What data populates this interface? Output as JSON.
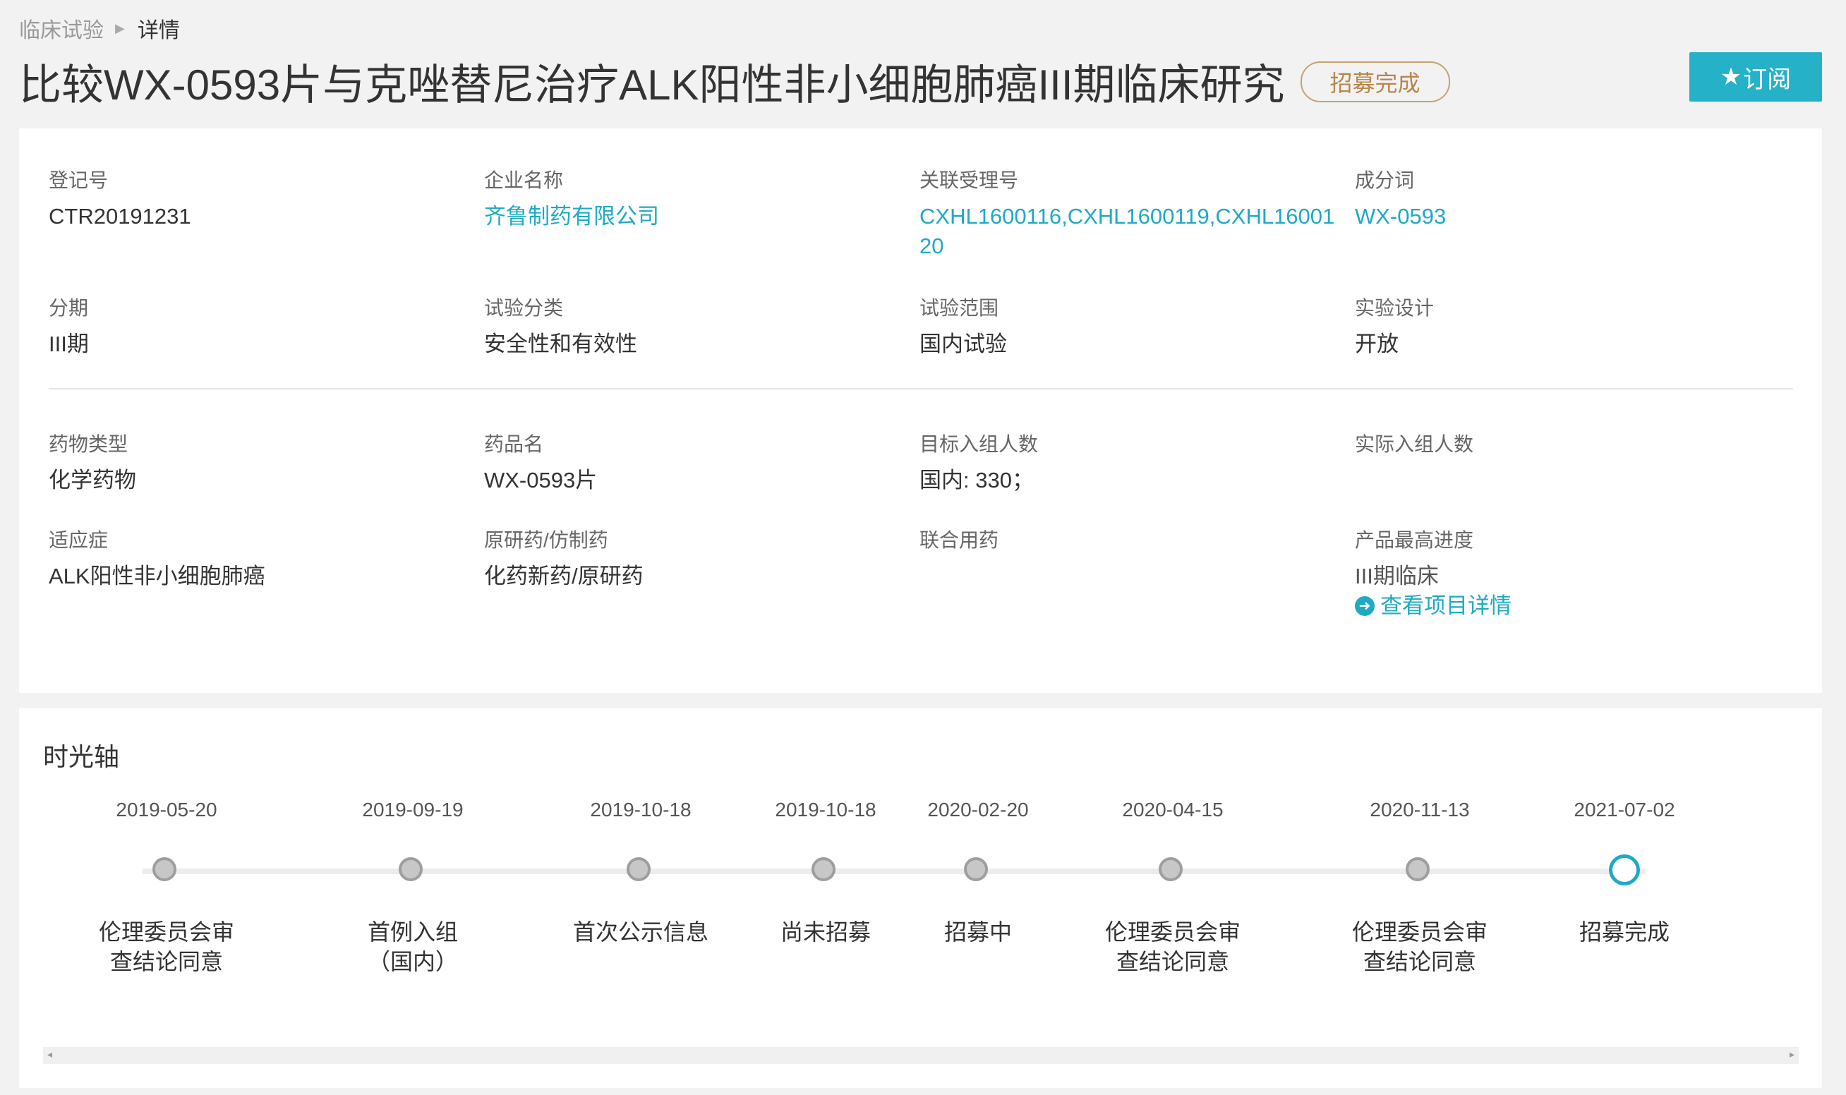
{
  "breadcrumb": {
    "parent": "临床试验",
    "current": "详情"
  },
  "header": {
    "title": "比较WX-0593片与克唑替尼治疗ALK阳性非小细胞肺癌III期临床研究",
    "status": "招募完成",
    "subscribe_label": "订阅"
  },
  "colors": {
    "accent": "#25b1c8",
    "link": "#1eaac3",
    "badge": "#c8a16e"
  },
  "fields": {
    "reg_no": {
      "label": "登记号",
      "value": "CTR20191231"
    },
    "company": {
      "label": "企业名称",
      "value": "齐鲁制药有限公司"
    },
    "related_accept": {
      "label": "关联受理号",
      "value": "CXHL1600116,CXHL1600119,CXHL1600120"
    },
    "ingredient": {
      "label": "成分词",
      "value": "WX-0593"
    },
    "phase": {
      "label": "分期",
      "value": "III期"
    },
    "trial_type": {
      "label": "试验分类",
      "value": "安全性和有效性"
    },
    "trial_scope": {
      "label": "试验范围",
      "value": "国内试验"
    },
    "design": {
      "label": "实验设计",
      "value": "开放"
    },
    "drug_type": {
      "label": "药物类型",
      "value": "化学药物"
    },
    "drug_name": {
      "label": "药品名",
      "value": "WX-0593片"
    },
    "target_enroll": {
      "label": "目标入组人数",
      "value": "国内: 330；"
    },
    "actual_enroll": {
      "label": "实际入组人数",
      "value": ""
    },
    "indication": {
      "label": "适应症",
      "value": "ALK阳性非小细胞肺癌"
    },
    "origin": {
      "label": "原研药/仿制药",
      "value": "化药新药/原研药"
    },
    "combo": {
      "label": "联合用药",
      "value": ""
    },
    "max_progress": {
      "label": "产品最高进度",
      "value": "III期临床",
      "link": "查看项目详情"
    }
  },
  "timeline": {
    "title": "时光轴",
    "items": [
      {
        "date": "2019-05-20",
        "label": "伦理委员会审查结论同意"
      },
      {
        "date": "2019-09-19",
        "label": "首例入组（国内）"
      },
      {
        "date": "2019-10-18",
        "label": "首次公示信息"
      },
      {
        "date": "2019-10-18",
        "label": "尚未招募"
      },
      {
        "date": "2020-02-20",
        "label": "招募中"
      },
      {
        "date": "2020-04-15",
        "label": "伦理委员会审查结论同意"
      },
      {
        "date": "2020-11-13",
        "label": "伦理委员会审查结论同意"
      },
      {
        "date": "2021-07-02",
        "label": "招募完成"
      }
    ]
  }
}
